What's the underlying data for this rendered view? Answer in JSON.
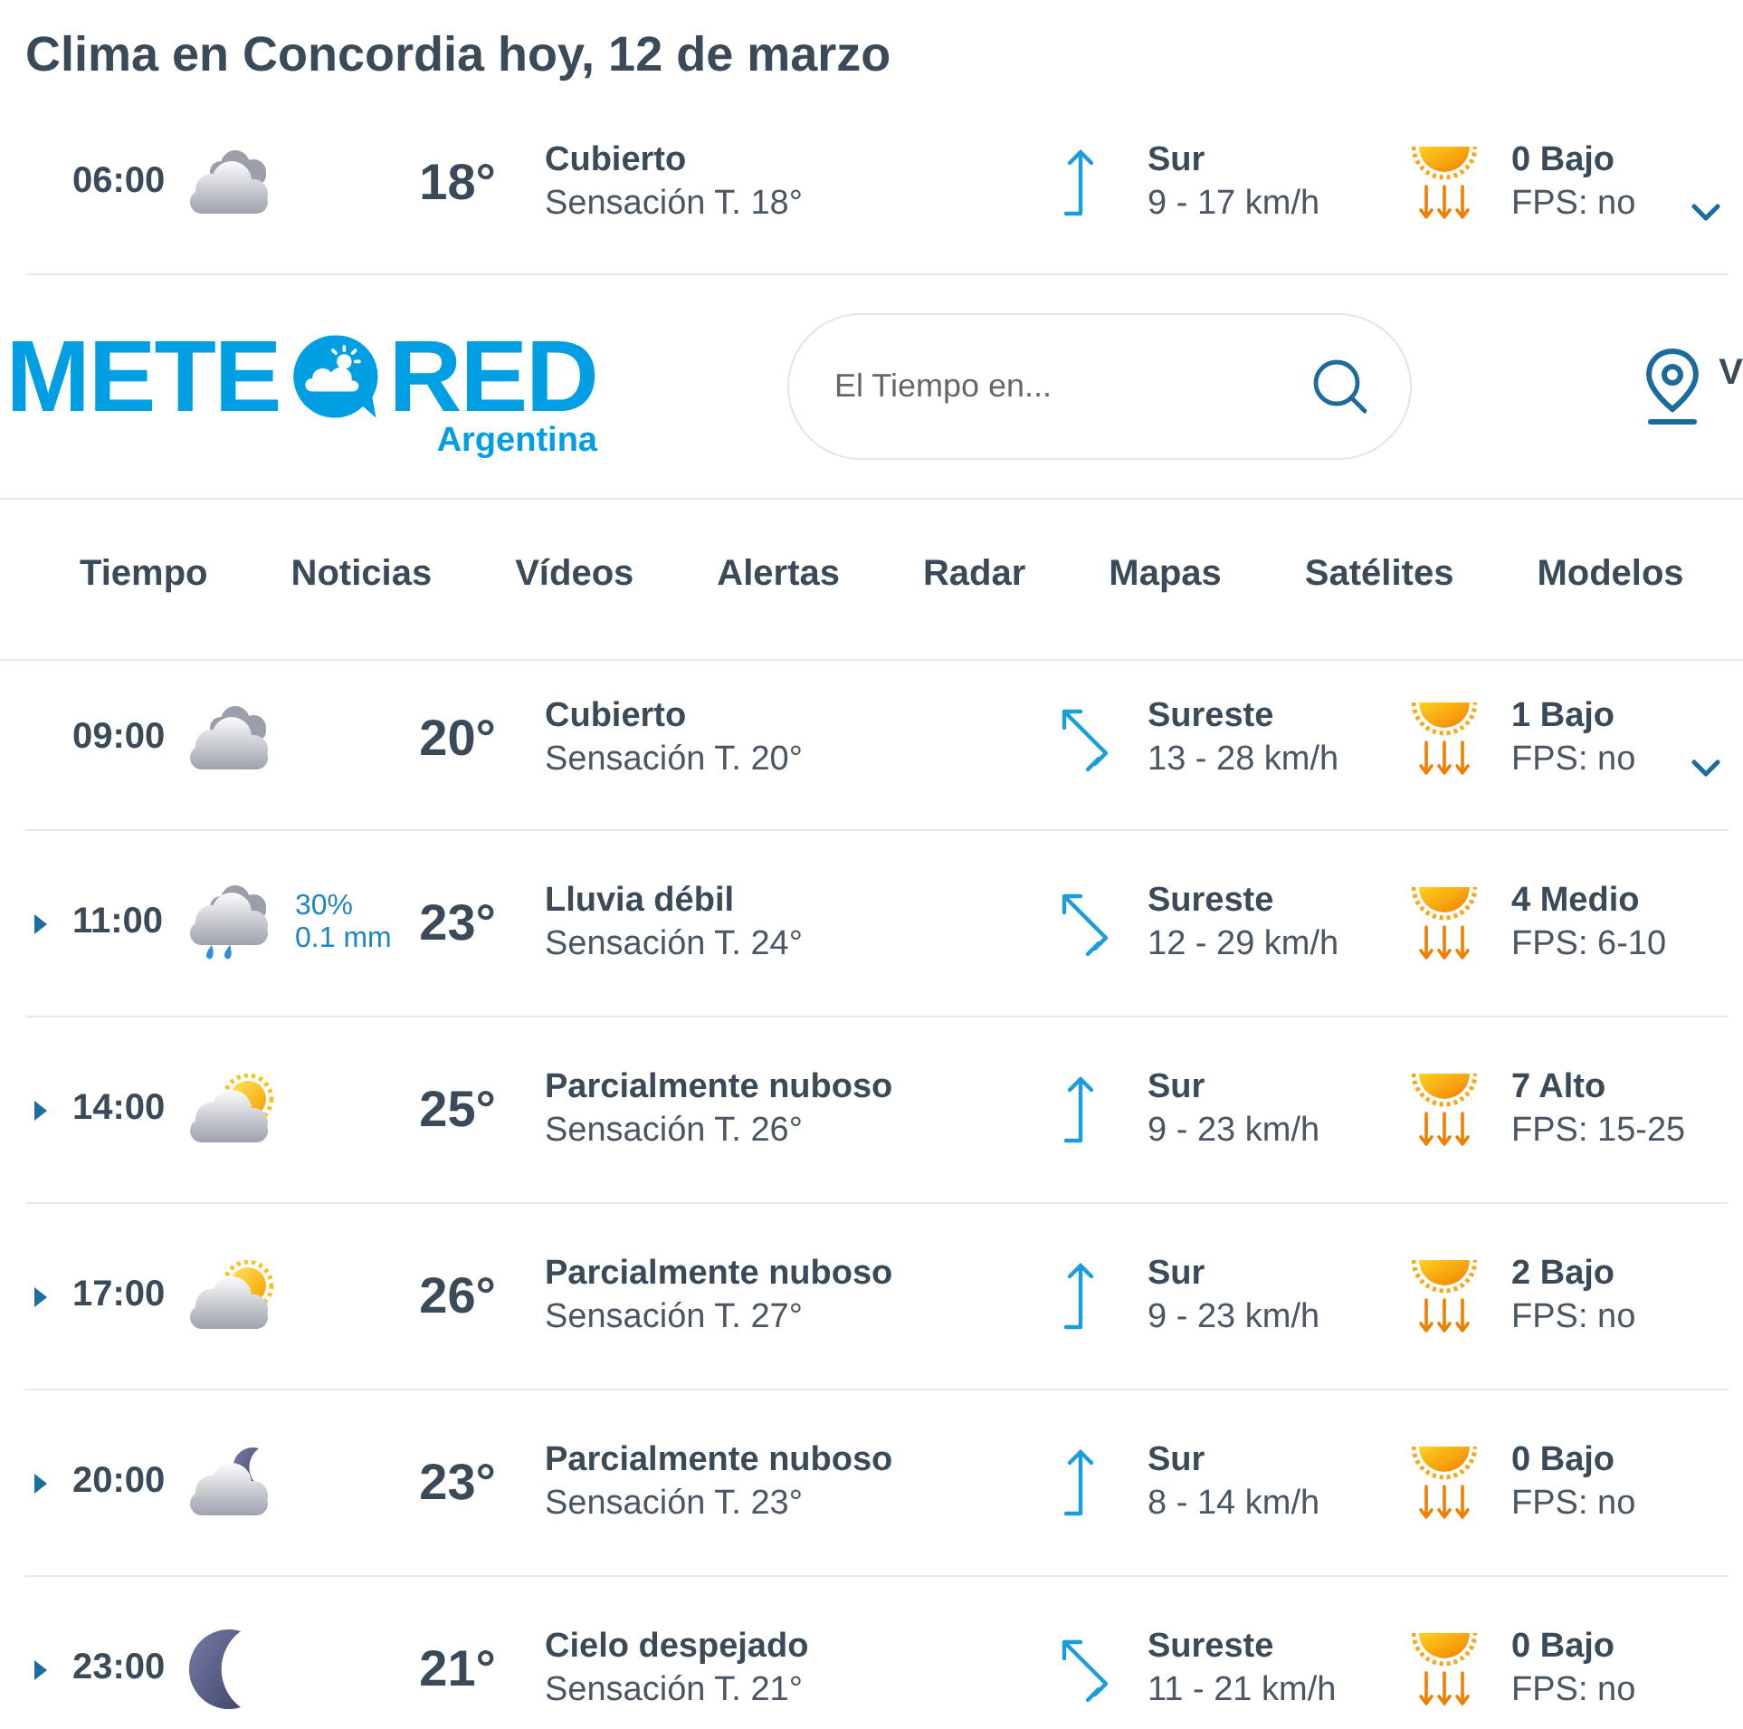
{
  "title": "Clima en Concordia hoy, 12 de marzo",
  "forecast_top": [
    {
      "time": "06:00",
      "icon": {
        "kind": "overcast"
      },
      "temperature": "18°",
      "condition": "Cubierto",
      "feels_like": "Sensación T. 18°",
      "wind": {
        "kind": "north",
        "direction": "Sur",
        "speed": "9 - 17 km/h"
      },
      "uv": "0 Bajo",
      "sunscreen": "FPS: no",
      "expander": {
        "kind": "chevron"
      }
    }
  ],
  "header": {
    "logo": {
      "left": "METE",
      "right": "RED",
      "region": "Argentina"
    },
    "search": {
      "placeholder": "El Tiempo en..."
    },
    "location": {
      "name": "V"
    }
  },
  "nav": [
    "Tiempo",
    "Noticias",
    "Vídeos",
    "Alertas",
    "Radar",
    "Mapas",
    "Satélites",
    "Modelos"
  ],
  "forecast": [
    {
      "time": "09:00",
      "icon": {
        "kind": "overcast"
      },
      "temperature": "20°",
      "condition": "Cubierto",
      "feels_like": "Sensación T. 20°",
      "wind": {
        "kind": "northwest",
        "direction": "Sureste",
        "speed": "13 - 28 km/h"
      },
      "uv": "1 Bajo",
      "sunscreen": "FPS: no",
      "expander": {
        "kind": "chevron"
      }
    },
    {
      "time": "11:00",
      "icon": {
        "kind": "rain"
      },
      "precip": {
        "chance": "30%",
        "amount": "0.1 mm"
      },
      "temperature": "23°",
      "condition": "Lluvia débil",
      "feels_like": "Sensación T. 24°",
      "wind": {
        "kind": "northwest",
        "direction": "Sureste",
        "speed": "12 - 29 km/h"
      },
      "uv": "4 Medio",
      "sunscreen": "FPS: 6-10",
      "expander": {
        "kind": "triangle"
      }
    },
    {
      "time": "14:00",
      "icon": {
        "kind": "sun_cloud"
      },
      "temperature": "25°",
      "condition": "Parcialmente nuboso",
      "feels_like": "Sensación T. 26°",
      "wind": {
        "kind": "north",
        "direction": "Sur",
        "speed": "9 - 23 km/h"
      },
      "uv": "7 Alto",
      "sunscreen": "FPS: 15-25",
      "expander": {
        "kind": "triangle"
      }
    },
    {
      "time": "17:00",
      "icon": {
        "kind": "sun_cloud"
      },
      "temperature": "26°",
      "condition": "Parcialmente nuboso",
      "feels_like": "Sensación T. 27°",
      "wind": {
        "kind": "north",
        "direction": "Sur",
        "speed": "9 - 23 km/h"
      },
      "uv": "2 Bajo",
      "sunscreen": "FPS: no",
      "expander": {
        "kind": "triangle"
      }
    },
    {
      "time": "20:00",
      "icon": {
        "kind": "moon_cloud"
      },
      "temperature": "23°",
      "condition": "Parcialmente nuboso",
      "feels_like": "Sensación T. 23°",
      "wind": {
        "kind": "north",
        "direction": "Sur",
        "speed": "8 - 14 km/h"
      },
      "uv": "0 Bajo",
      "sunscreen": "FPS: no",
      "expander": {
        "kind": "triangle"
      }
    },
    {
      "time": "23:00",
      "icon": {
        "kind": "moon"
      },
      "temperature": "21°",
      "condition": "Cielo despejado",
      "feels_like": "Sensación T. 21°",
      "wind": {
        "kind": "northwest",
        "direction": "Sureste",
        "speed": "11 - 21 km/h"
      },
      "uv": "0 Bajo",
      "sunscreen": "FPS: no",
      "expander": {
        "kind": "triangle"
      }
    }
  ]
}
